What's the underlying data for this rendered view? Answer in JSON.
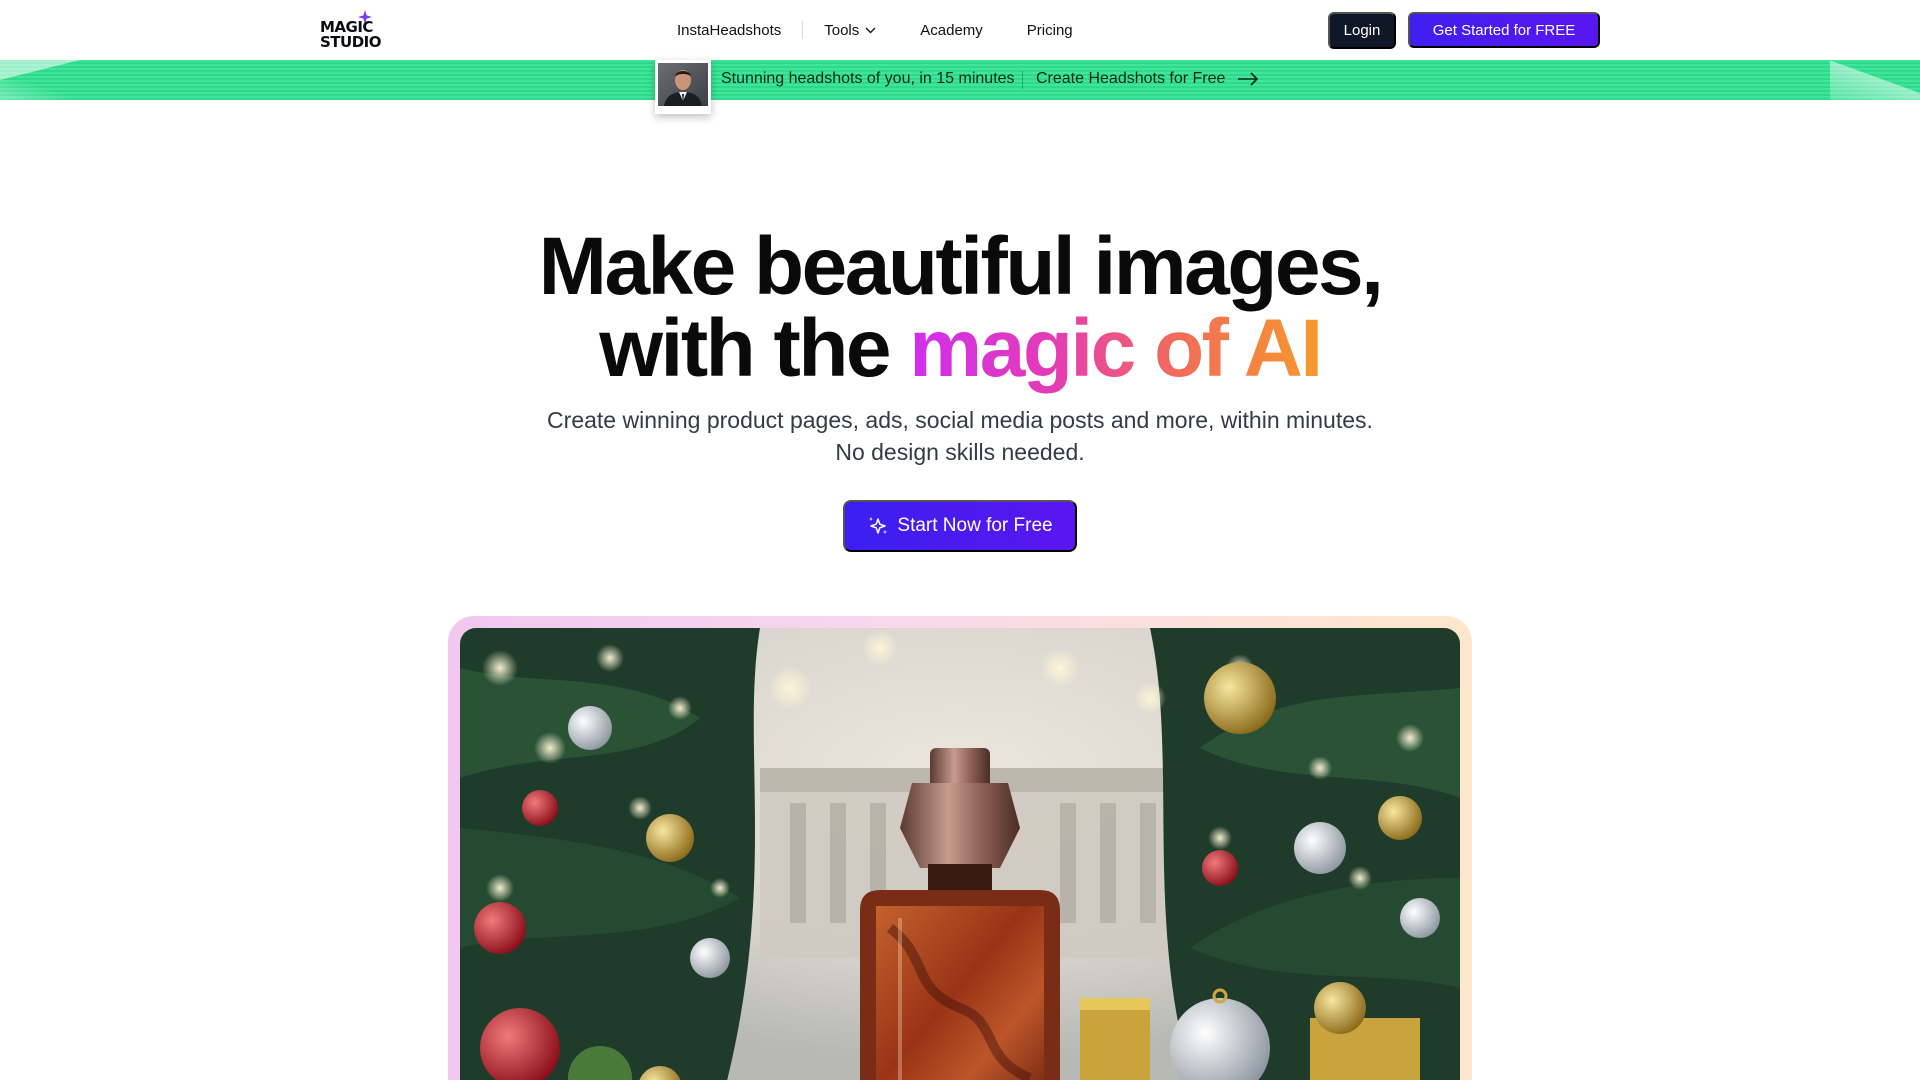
{
  "nav": {
    "logo_line1": "MAGIC",
    "logo_line2": "STUDIO",
    "links": [
      {
        "label": "InstaHeadshots"
      },
      {
        "label": "Tools"
      },
      {
        "label": "Academy"
      },
      {
        "label": "Pricing"
      }
    ],
    "login_label": "Login",
    "get_started_label": "Get Started for FREE"
  },
  "banner": {
    "text": "Stunning headshots of you, in 15 minutes",
    "link_label": "Create Headshots for Free",
    "icons": [
      "headshot-photo",
      "arrow-right-icon"
    ]
  },
  "hero": {
    "title_line1": "Make beautiful images,",
    "title_line2_prefix": "with the ",
    "title_line2_highlight": "magic of AI",
    "subtitle_line1": "Create winning product pages, ads, social media posts and more, within minutes.",
    "subtitle_line2": "No design skills needed.",
    "cta_label": "Start Now for Free",
    "cta_icon": "sparkle-icon"
  },
  "colors": {
    "primary": "#4a1bef",
    "dark": "#101828",
    "banner_green": "#33dd90",
    "gradient_start": "#d02ef0",
    "gradient_end": "#f59a2c"
  },
  "showcase": {
    "subject": "perfume-bottle-christmas-scene"
  }
}
